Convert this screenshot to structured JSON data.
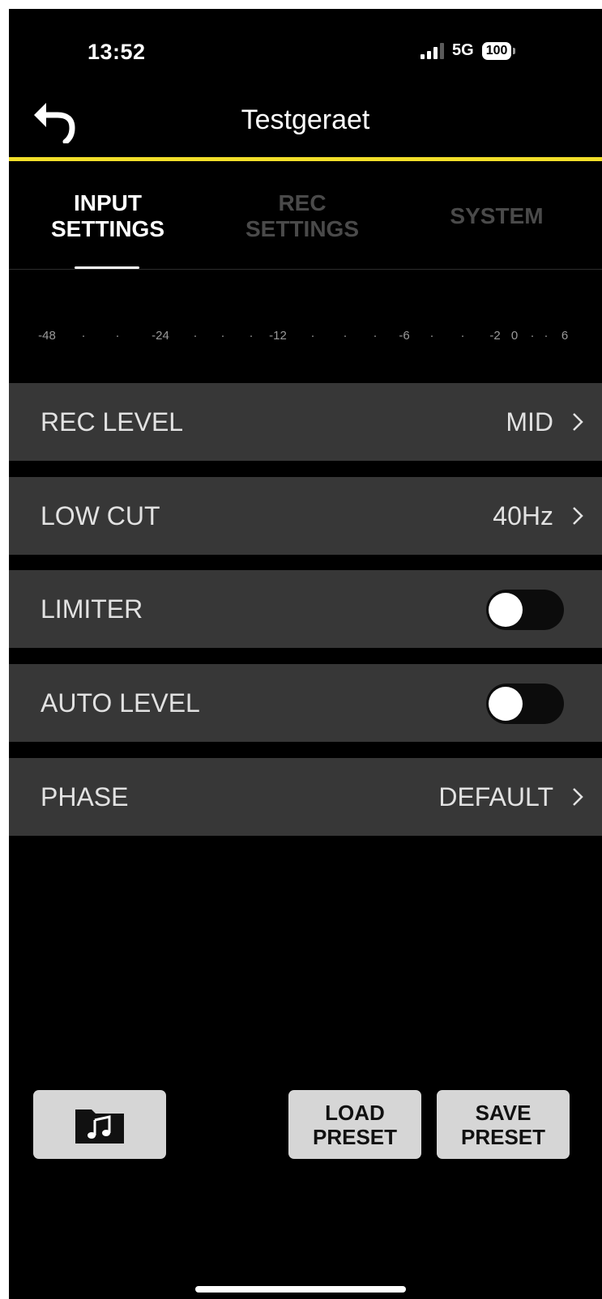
{
  "status_bar": {
    "time": "13:52",
    "network": "5G",
    "battery": "100"
  },
  "nav": {
    "title": "Testgeraet",
    "back_icon": "undo-arrow-icon"
  },
  "tabs": [
    {
      "label": "INPUT\nSETTINGS",
      "active": true
    },
    {
      "label": "REC\nSETTINGS",
      "active": false
    },
    {
      "label": "SYSTEM",
      "active": false
    }
  ],
  "meter_scale": [
    "-48",
    "·",
    "·",
    "-24",
    "·",
    "·",
    "·",
    "-12",
    "·",
    "·",
    "·",
    "-6",
    "·",
    "·",
    "-2",
    "0",
    "·",
    "·",
    "6"
  ],
  "settings": {
    "rec_level": {
      "label": "REC LEVEL",
      "value": "MID"
    },
    "low_cut": {
      "label": "LOW CUT",
      "value": "40Hz"
    },
    "limiter": {
      "label": "LIMITER",
      "on": false
    },
    "auto_level": {
      "label": "AUTO LEVEL",
      "on": false
    },
    "phase": {
      "label": "PHASE",
      "value": "DEFAULT"
    }
  },
  "footer": {
    "folder_icon": "music-folder-icon",
    "load_preset": "LOAD\nPRESET",
    "save_preset": "SAVE\nPRESET"
  },
  "colors": {
    "accent": "#f2df2a",
    "row_background": "#373737",
    "inactive_tab": "#4a4a4a"
  }
}
